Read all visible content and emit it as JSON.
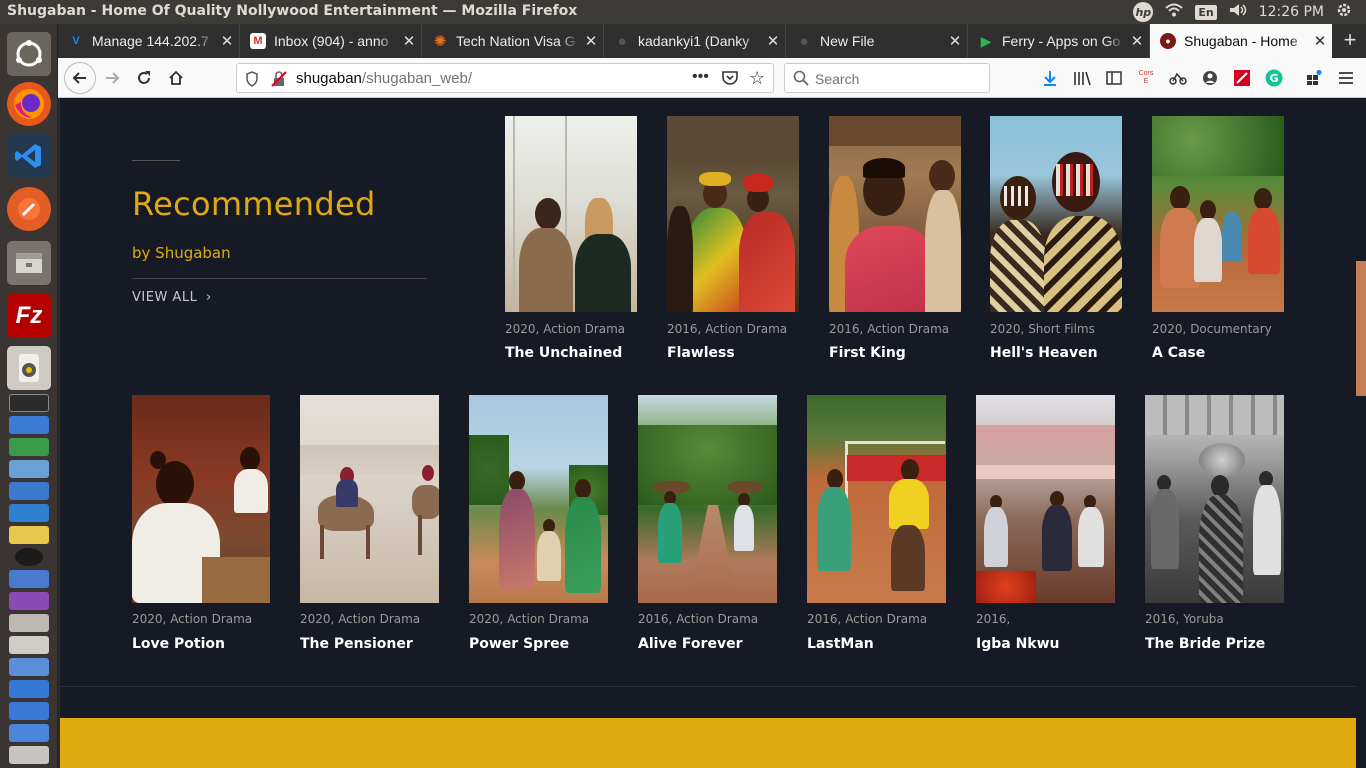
{
  "os": {
    "window_title": "Shugaban - Home Of Quality Nollywood Entertainment — Mozilla Firefox",
    "lang": "En",
    "clock": "12:26 PM",
    "hp_label": "hp"
  },
  "tabs": [
    {
      "label": "Manage 144.202.7",
      "favicon": "vultr-icon",
      "color": "#1e88e5",
      "glyph": "V"
    },
    {
      "label": "Inbox (904) - anno",
      "favicon": "gmail-icon",
      "color": "#ffffff",
      "glyph": "M"
    },
    {
      "label": "Tech Nation Visa G",
      "favicon": "sun-icon",
      "color": "#e8731a",
      "glyph": "✺"
    },
    {
      "label": "kadankyi1 (Danky",
      "favicon": "github-icon",
      "color": "#444444",
      "glyph": "●"
    },
    {
      "label": "New File",
      "favicon": "github-icon",
      "color": "#444444",
      "glyph": "●"
    },
    {
      "label": "Ferry - Apps on Go",
      "favicon": "play-store-icon",
      "color": "#2fb257",
      "glyph": "▶"
    },
    {
      "label": "Shugaban - Home",
      "favicon": "shugaban-icon",
      "color": "#7b1a12",
      "glyph": "●"
    }
  ],
  "url": {
    "domain": "shugaban",
    "path": "/shugaban_web/"
  },
  "search": {
    "placeholder": "Search"
  },
  "extension_labels": {
    "cors": "Cors E"
  },
  "section": {
    "title": "Recommended",
    "subtitle": "by Shugaban",
    "view_all": "VIEW ALL",
    "view_all_arrow": "›"
  },
  "movies_row1": [
    {
      "year": "2020,",
      "genre": "Action Drama",
      "title": "The Unchained"
    },
    {
      "year": "2016,",
      "genre": "Action Drama",
      "title": "Flawless"
    },
    {
      "year": "2016,",
      "genre": "Action Drama",
      "title": "First King"
    },
    {
      "year": "2020,",
      "genre": "Short Films",
      "title": "Hell's Heaven"
    },
    {
      "year": "2020,",
      "genre": "Documentary",
      "title": "A Case"
    }
  ],
  "movies_row2": [
    {
      "year": "2020,",
      "genre": "Action Drama",
      "title": "Love Potion"
    },
    {
      "year": "2020,",
      "genre": "Action Drama",
      "title": "The Pensioner"
    },
    {
      "year": "2020,",
      "genre": "Action Drama",
      "title": "Power Spree"
    },
    {
      "year": "2016,",
      "genre": "Action Drama",
      "title": "Alive Forever"
    },
    {
      "year": "2016,",
      "genre": "Action Drama",
      "title": "LastMan"
    },
    {
      "year": "2016,",
      "genre": "",
      "title": "Igba Nkwu"
    },
    {
      "year": "2016,",
      "genre": "Yoruba",
      "title": "The Bride Prize"
    }
  ],
  "colors": {
    "accent": "#e0aa0f",
    "page_bg": "#161a24"
  }
}
